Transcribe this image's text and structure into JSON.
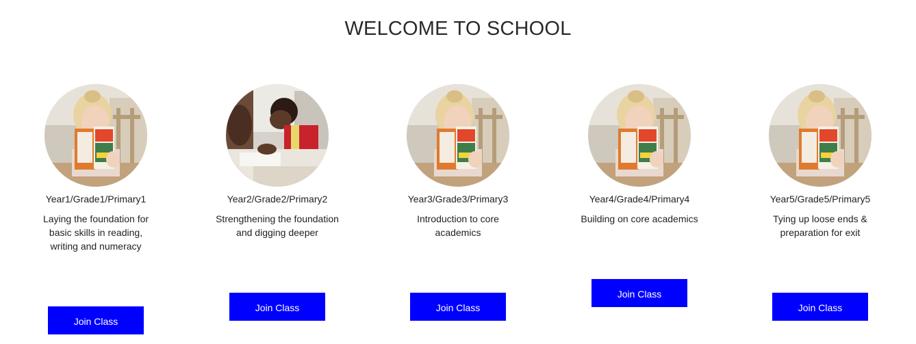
{
  "header": {
    "title": "WELCOME TO SCHOOL"
  },
  "classes": [
    {
      "title": "Year1/Grade1/Primary1",
      "description": "Laying the foundation for basic skills in reading, writing and numeracy",
      "button_label": "Join Class",
      "image": "girl-reading-book-photo"
    },
    {
      "title": "Year2/Grade2/Primary2",
      "description": "Strengthening the foundation and digging deeper",
      "button_label": "Join Class",
      "image": "boy-writing-at-desk-photo"
    },
    {
      "title": "Year3/Grade3/Primary3",
      "description": "Introduction to core academics",
      "button_label": "Join Class",
      "image": "girl-reading-book-photo"
    },
    {
      "title": "Year4/Grade4/Primary4",
      "description": "Building on core academics",
      "button_label": "Join Class",
      "image": "girl-reading-book-photo"
    },
    {
      "title": "Year5/Grade5/Primary5",
      "description": "Tying up loose ends & preparation for exit",
      "button_label": "Join Class",
      "image": "girl-reading-book-photo"
    }
  ],
  "colors": {
    "button_bg": "#0000ff",
    "button_text": "#ffffff",
    "title_text": "#2a2a2a"
  }
}
